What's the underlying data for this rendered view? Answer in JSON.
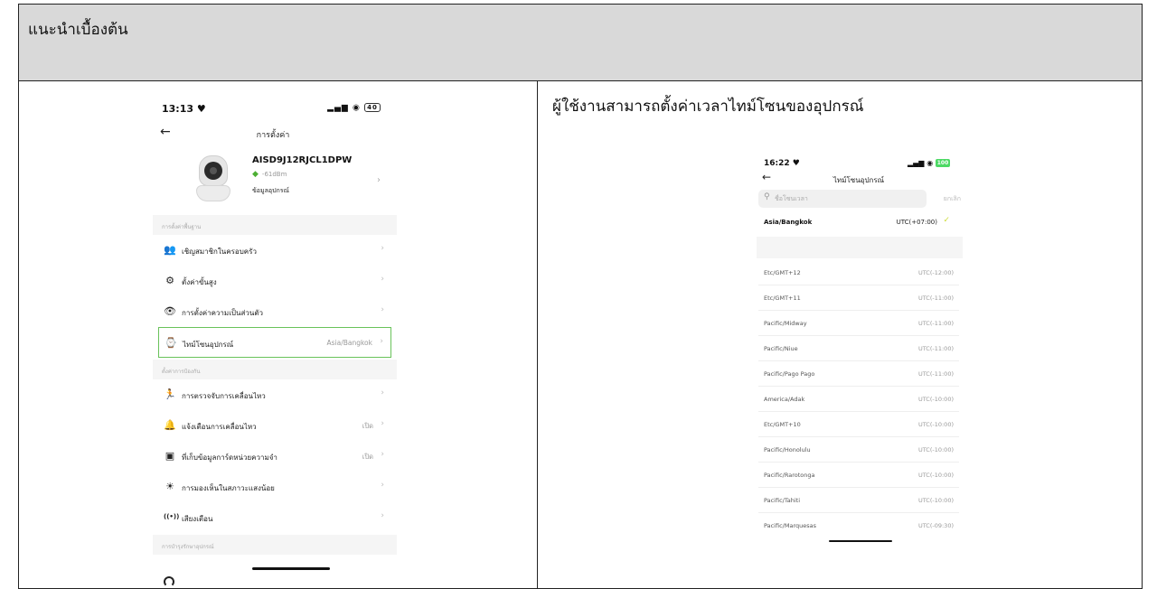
{
  "doc": {
    "header_title": "แนะนำเบื้องต้น",
    "description": "ผู้ใช้งานสามารถตั้งค่าเวลาไทม์โซนของอุปกรณ์"
  },
  "screen1": {
    "status_time": "13:13 ♥",
    "status_icons": "▂▄▆ ◉",
    "battery": "40",
    "nav_title": "การตั้งค่า",
    "device_name": "AISD9J12RJCL1DPW",
    "wifi_signal": "-61dBm",
    "device_info_label": "ข้อมูลอุปกรณ์",
    "sections": {
      "basic": "การตั้งค่าพื้นฐาน",
      "protection": "ตั้งค่าการป้องกัน",
      "maintenance": "การบำรุงรักษาอุปกรณ์"
    },
    "rows": [
      {
        "icon": "👥",
        "label": "เชิญสมาชิกในครอบครัว",
        "value": ""
      },
      {
        "icon": "⚙",
        "label": "ตั้งค่าขั้นสูง",
        "value": ""
      },
      {
        "icon": "👁",
        "label": "การตั้งค่าความเป็นส่วนตัว",
        "value": ""
      },
      {
        "icon": "⌚",
        "label": "ไทม์โซนอุปกรณ์",
        "value": "Asia/Bangkok"
      },
      {
        "icon": "🏃",
        "label": "การตรวจจับการเคลื่อนไหว",
        "value": ""
      },
      {
        "icon": "🔔",
        "label": "แจ้งเตือนการเคลื่อนไหว",
        "value": "เปิด"
      },
      {
        "icon": "▣",
        "label": "ที่เก็บข้อมูลการ์ดหน่วยความจำ",
        "value": "เปิด"
      },
      {
        "icon": "☀",
        "label": "การมองเห็นในสภาวะแสงน้อย",
        "value": ""
      },
      {
        "icon": "((•))",
        "label": "เสียงเตือน",
        "value": ""
      }
    ]
  },
  "screen2": {
    "status_time": "16:22 ♥",
    "status_icons": "▂▄▆ ◉",
    "battery": "100",
    "nav_title": "ไทม์โซนอุปกรณ์",
    "search_placeholder": "ชื่อโซนเวลา",
    "cancel_label": "ยกเลิก",
    "current": {
      "name": "Asia/Bangkok",
      "offset": "UTC(+07:00)"
    },
    "zones": [
      {
        "name": "Etc/GMT+12",
        "offset": "UTC(-12:00)"
      },
      {
        "name": "Etc/GMT+11",
        "offset": "UTC(-11:00)"
      },
      {
        "name": "Pacific/Midway",
        "offset": "UTC(-11:00)"
      },
      {
        "name": "Pacific/Niue",
        "offset": "UTC(-11:00)"
      },
      {
        "name": "Pacific/Pago Pago",
        "offset": "UTC(-11:00)"
      },
      {
        "name": "America/Adak",
        "offset": "UTC(-10:00)"
      },
      {
        "name": "Etc/GMT+10",
        "offset": "UTC(-10:00)"
      },
      {
        "name": "Pacific/Honolulu",
        "offset": "UTC(-10:00)"
      },
      {
        "name": "Pacific/Rarotonga",
        "offset": "UTC(-10:00)"
      },
      {
        "name": "Pacific/Tahiti",
        "offset": "UTC(-10:00)"
      },
      {
        "name": "Pacific/Marquesas",
        "offset": "UTC(-09:30)"
      }
    ]
  }
}
